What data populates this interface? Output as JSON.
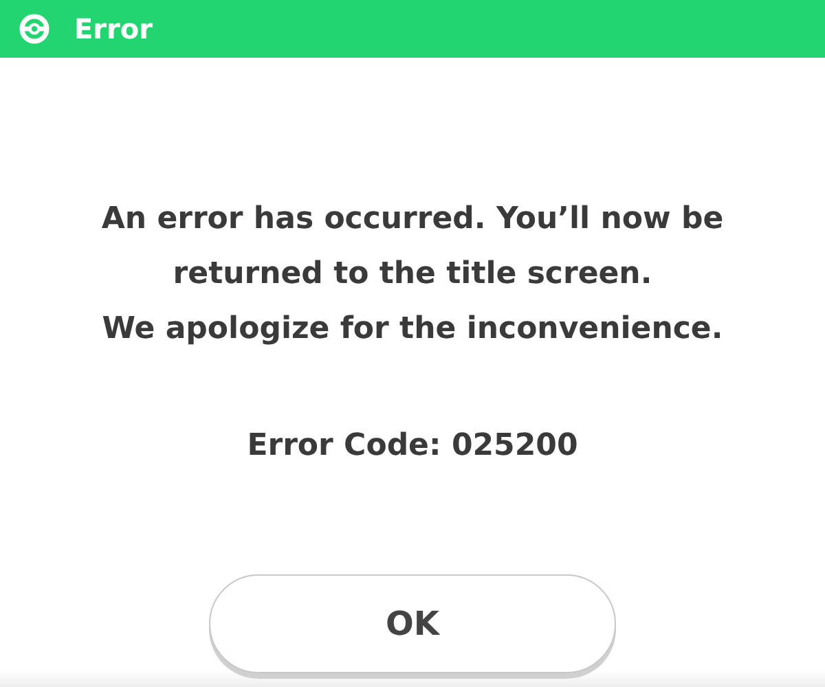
{
  "window": {
    "title": "Error"
  },
  "message": [
    "An error has occurred. You’ll now be returned to the title screen.",
    "We apologize for the inconvenience."
  ],
  "error_code": "Error Code: 025200",
  "buttons": [
    "OK"
  ]
}
